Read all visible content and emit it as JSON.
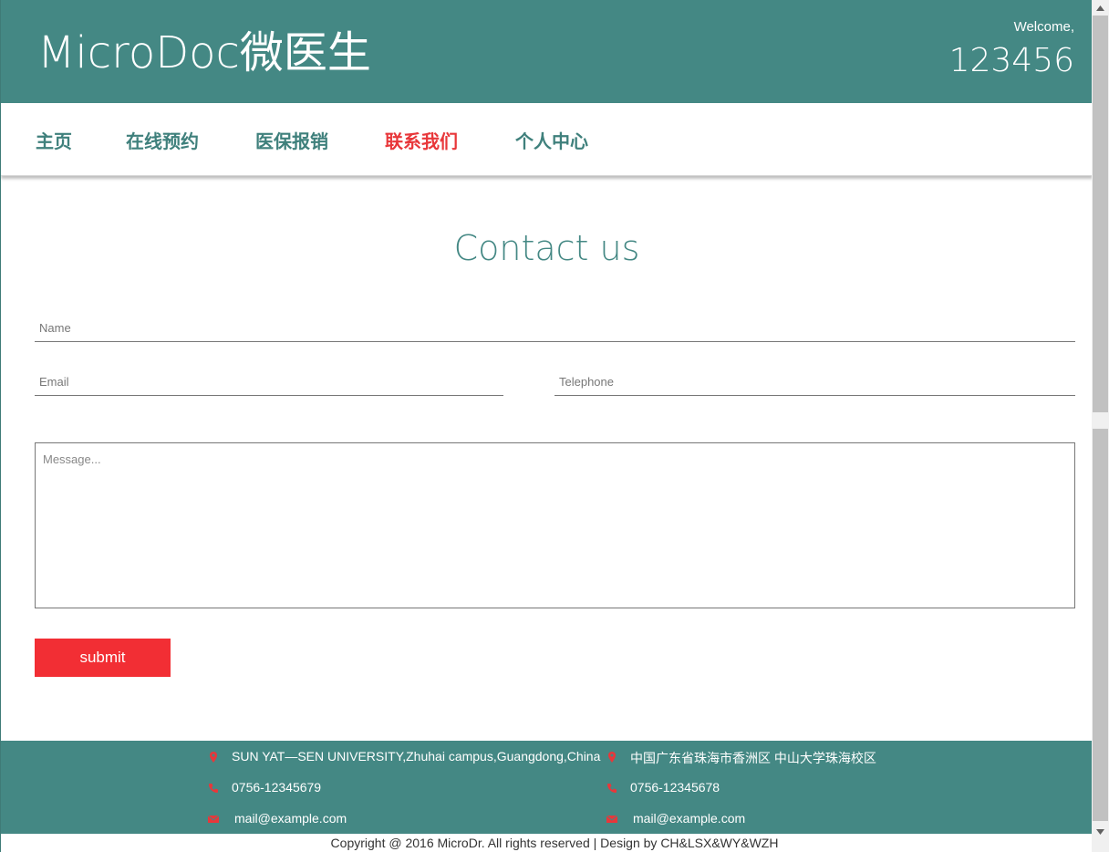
{
  "header": {
    "brand": "MicroDoc微医生",
    "welcome": "Welcome,",
    "user": "123456"
  },
  "nav": {
    "items": [
      {
        "label": "主页"
      },
      {
        "label": "在线预约"
      },
      {
        "label": "医保报销"
      },
      {
        "label": "联系我们",
        "active": true
      },
      {
        "label": "个人中心"
      }
    ]
  },
  "contact": {
    "title": "Contact us",
    "name_placeholder": "Name",
    "email_placeholder": "Email",
    "telephone_placeholder": "Telephone",
    "message_placeholder": "Message...",
    "submit_label": "submit"
  },
  "footer": {
    "left": {
      "address": "SUN YAT—SEN UNIVERSITY,Zhuhai campus,Guangdong,China",
      "phone": "0756-12345679",
      "email": "mail@example.com"
    },
    "right": {
      "address": "中国广东省珠海市香洲区 中山大学珠海校区",
      "phone": "0756-12345678",
      "email": "mail@example.com"
    },
    "copyright": "Copyright @ 2016 MicroDr. All rights reserved | Design by CH&LSX&WY&WZH"
  },
  "colors": {
    "brand": "#448884",
    "accent": "#f22e34"
  },
  "icons": [
    "map-marker-icon",
    "phone-icon",
    "envelope-icon"
  ]
}
